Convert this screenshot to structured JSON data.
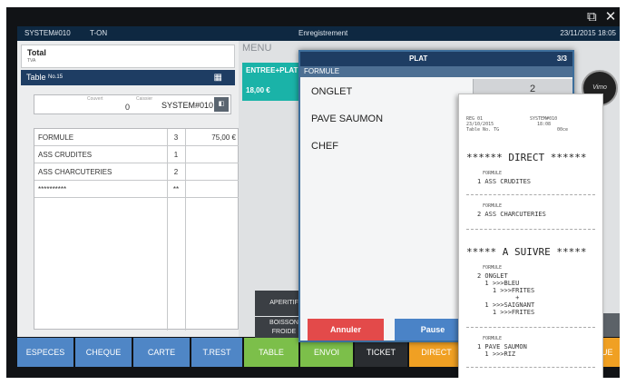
{
  "window": {
    "ctrl_popout": "⧉",
    "ctrl_close": "✕"
  },
  "titlebar": {
    "system": "SYSTEM#010",
    "user": "T-ON",
    "title": "Enregistrement",
    "datetime": "23/11/2015 18:05"
  },
  "left": {
    "total_label": "Total",
    "total_sub": "TVA",
    "table_label": "Table",
    "table_no": "No.15",
    "covers_label": "Couvert",
    "covers_value": "0",
    "cashier_label": "Caissier",
    "cashier_value": "SYSTEM#010",
    "items": [
      {
        "name": "FORMULE",
        "qty": "3",
        "price": "75,00 €"
      },
      {
        "name": "ASS CRUDITES",
        "qty": "1",
        "price": ""
      },
      {
        "name": "ASS CHARCUTERIES",
        "qty": "2",
        "price": ""
      },
      {
        "name": "**********",
        "qty": "**",
        "price": ""
      }
    ]
  },
  "bottom_buttons": [
    {
      "label": "ESPECES",
      "color": "#4f86c6"
    },
    {
      "label": "CHEQUE",
      "color": "#4f86c6"
    },
    {
      "label": "CARTE",
      "color": "#4f86c6"
    },
    {
      "label": "T.REST",
      "color": "#4f86c6"
    },
    {
      "label": "TABLE",
      "color": "#7cbf4a"
    },
    {
      "label": "ENVOI",
      "color": "#7cbf4a"
    },
    {
      "label": "TICKET",
      "color": "#2a2d31"
    },
    {
      "label": "DIRECT",
      "color": "#f0a023"
    },
    {
      "label": "NUE",
      "color": "#f0a023"
    }
  ],
  "menu": {
    "label": "MENU",
    "category": "ENTREE+PLAT",
    "category_price": "18,00 €",
    "aperitif": "APERITIF",
    "boisson_line1": "BOISSON",
    "boisson_line2": "FROIDE",
    "logo_text": "Vimo"
  },
  "dialog": {
    "title": "PLAT",
    "page": "3/3",
    "subtitle": "FORMULE",
    "dishes": [
      "ONGLET",
      "PAVE SAUMON",
      "CHEF"
    ],
    "qty": "2",
    "cancel": "Annuler",
    "pause": "Pause"
  },
  "receipt": {
    "hdr_l1": "REG 01",
    "hdr_l2": "23/10/2015",
    "hdr_l3": "Table No. TG",
    "hdr_r1": "SYSTEM#010",
    "hdr_r2": "18:08",
    "hdr_r3": "00ce",
    "direct": "****** DIRECT ******",
    "b1_small": "FORMULE",
    "b1_line": "1 ASS CRUDITES",
    "b2_small": "FORMULE",
    "b2_line": "2 ASS CHARCUTERIES",
    "suivre": "***** A SUIVRE *****",
    "b3_small": "FORMULE",
    "b3_lines": [
      "2 ONGLET",
      "  1 >>>BLEU",
      "    1 >>>FRITES",
      "          +",
      "  1 >>>SAIGNANT",
      "    1 >>>FRITES"
    ],
    "b4_small": "FORMULE",
    "b4_lines": [
      "1 PAVE SAUMON",
      "  1 >>>RIZ"
    ]
  }
}
